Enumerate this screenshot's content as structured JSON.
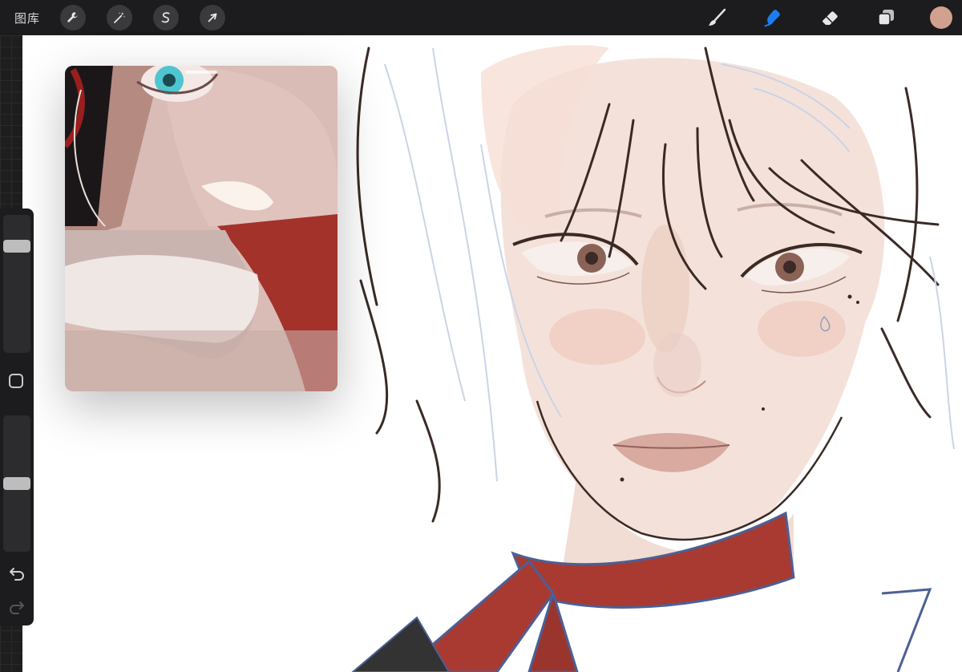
{
  "topbar": {
    "gallery_label": "图库",
    "left_tools": [
      "wrench-icon",
      "magic-wand-icon",
      "selection-s-icon",
      "transform-arrow-icon"
    ],
    "right_tools": [
      "brush-icon",
      "smudge-icon",
      "eraser-icon",
      "layers-icon"
    ],
    "active_tool": "smudge-icon",
    "active_color": "#d2a08f",
    "accent": "#1f7cf0"
  },
  "sidebar": {
    "brush_size": 0.8,
    "brush_opacity": 0.5,
    "icons": [
      "undo-icon",
      "redo-icon",
      "modify-square-icon"
    ]
  },
  "reference": {
    "panel": "reference-image"
  }
}
